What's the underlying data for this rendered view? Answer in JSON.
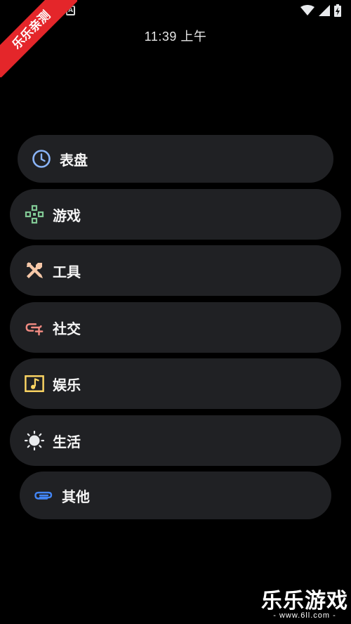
{
  "status_bar": {
    "time": "11:39 上午"
  },
  "ribbon": {
    "text": "乐乐亲测"
  },
  "menu": {
    "items": [
      {
        "label": "表盘",
        "icon": "clock-icon",
        "color": "#8ab4f8"
      },
      {
        "label": "游戏",
        "icon": "gamepad-icon",
        "color": "#81c995"
      },
      {
        "label": "工具",
        "icon": "tools-icon",
        "color": "#f6c8a8"
      },
      {
        "label": "社交",
        "icon": "link-add-icon",
        "color": "#f28b82"
      },
      {
        "label": "娱乐",
        "icon": "music-note-icon",
        "color": "#fdd663"
      },
      {
        "label": "生活",
        "icon": "sun-icon",
        "color": "#e8eaed"
      },
      {
        "label": "其他",
        "icon": "paperclip-icon",
        "color": "#4285f4"
      }
    ]
  },
  "watermark": {
    "title": "乐乐游戏",
    "url": "- www.6ll.com -"
  }
}
